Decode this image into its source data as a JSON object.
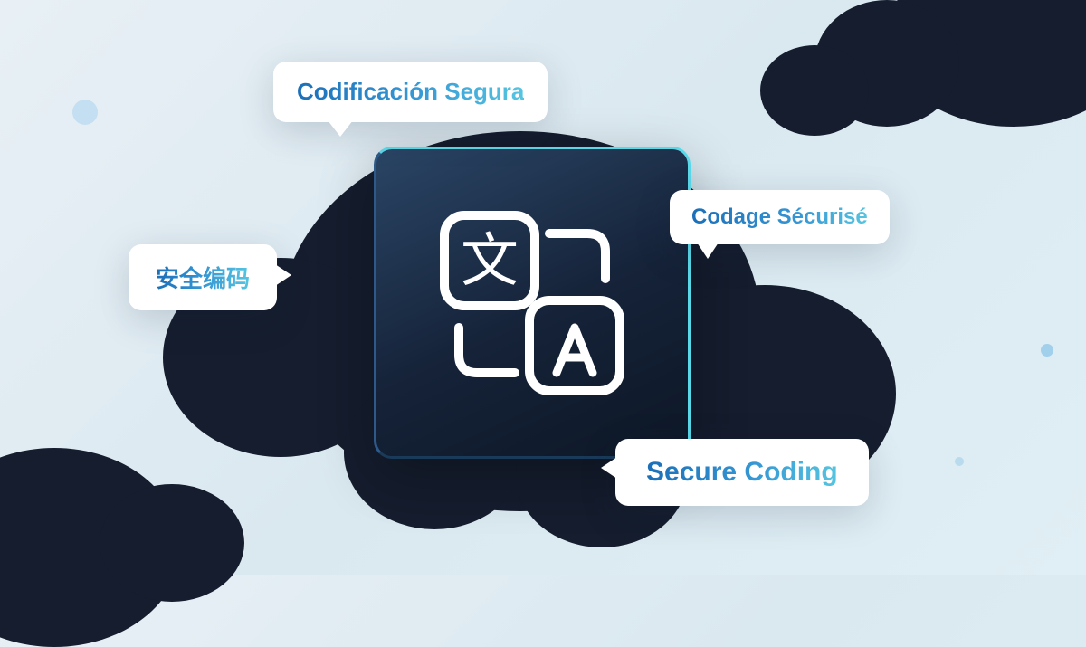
{
  "bubbles": {
    "top": "Codificación Segura",
    "left": "安全编码",
    "right": "Codage Sécurisé",
    "bottom": "Secure Coding"
  },
  "icon": "translate-icon",
  "colors": {
    "gradient_start": "#1b6fb8",
    "gradient_end": "#56c5e0",
    "card_dark": "#0d1726",
    "card_border": "#5bd8e8"
  }
}
